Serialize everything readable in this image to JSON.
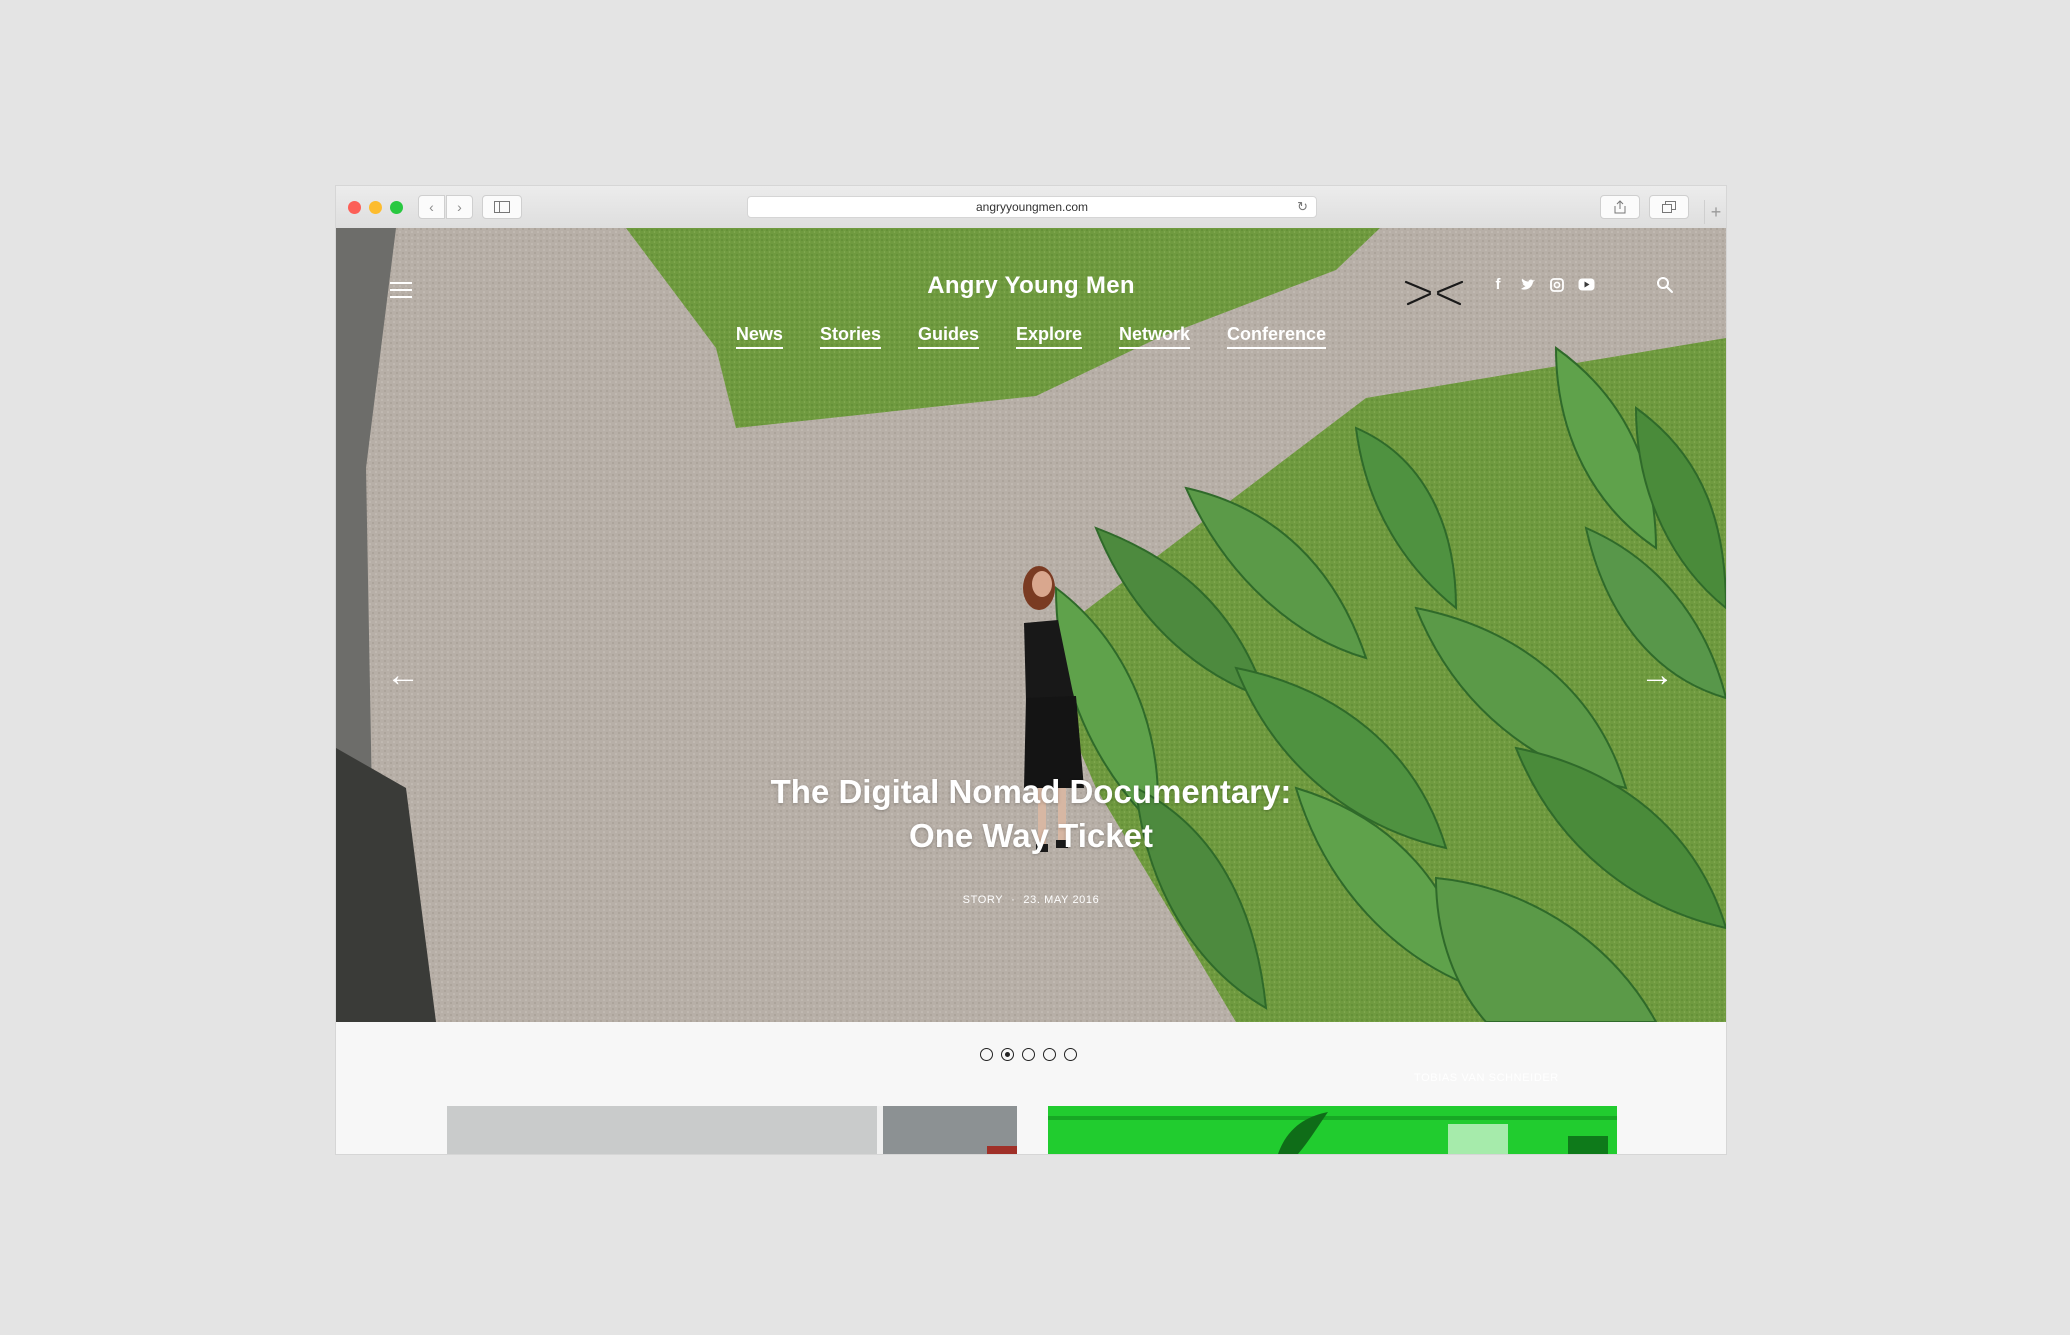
{
  "browser": {
    "url": "angryyoungmen.com",
    "reload_icon": "reload-icon",
    "new_tab_icon": "plus-icon"
  },
  "site": {
    "title": "Angry Young Men",
    "nav": [
      "News",
      "Stories",
      "Guides",
      "Explore",
      "Network",
      "Conference"
    ],
    "social": [
      "f",
      "t",
      "ig",
      "yt"
    ]
  },
  "hero": {
    "title_line1": "The Digital Nomad Documentary:",
    "title_line2": "One Way Ticket",
    "category": "STORY",
    "date": "23. MAY 2016",
    "prev_arrow": "←",
    "next_arrow": "→"
  },
  "slider": {
    "count": 5,
    "active_index": 1
  },
  "credit": "TOBIAS VAN SCHNEIDER",
  "colors": {
    "background": "#e4e4e4",
    "page": "#f7f7f7",
    "text_on_image": "#ffffff",
    "accent_green": "#1ec92c"
  }
}
